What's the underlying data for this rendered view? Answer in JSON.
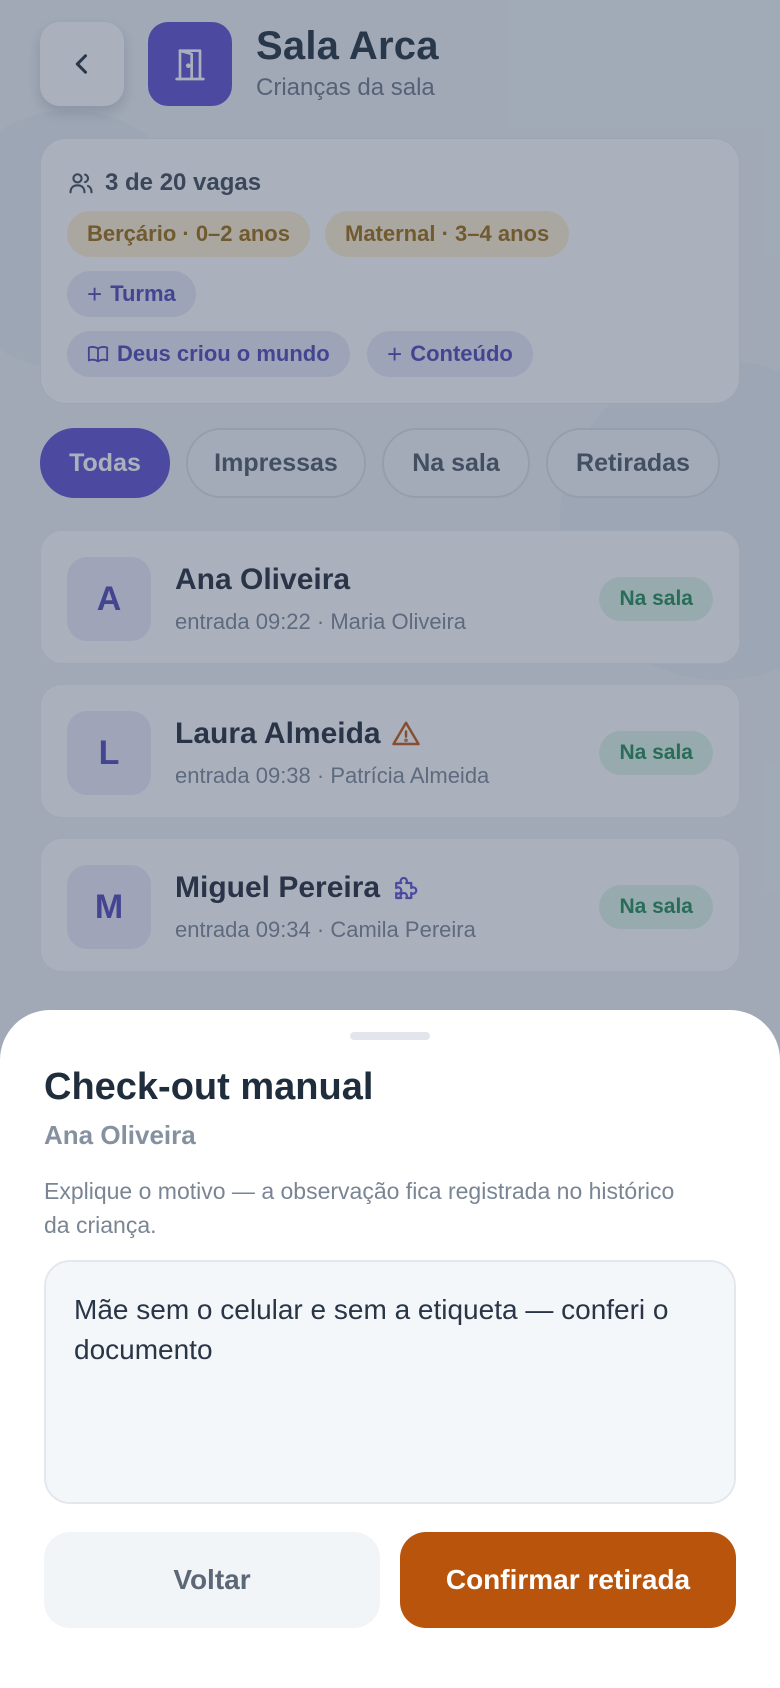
{
  "header": {
    "title": "Sala Arca",
    "subtitle": "Crianças da sala",
    "back_icon": "chevron-left-icon",
    "room_icon": "door-icon"
  },
  "info": {
    "vagas": "3 de 20 vagas",
    "age_groups": [
      "Berçário · 0–2 anos",
      "Maternal · 3–4 anos"
    ],
    "add_turma": "Turma",
    "content": "Deus criou o mundo",
    "add_conteudo": "Conteúdo"
  },
  "filters": [
    "Todas",
    "Impressas",
    "Na sala",
    "Retiradas"
  ],
  "filter_active": "Todas",
  "children": [
    {
      "initial": "A",
      "name": "Ana Oliveira",
      "meta": "entrada 09:22 · Maria Oliveira",
      "status": "Na sala",
      "flag": ""
    },
    {
      "initial": "L",
      "name": "Laura Almeida",
      "meta": "entrada 09:38 · Patrícia Almeida",
      "status": "Na sala",
      "flag": "warning-icon"
    },
    {
      "initial": "M",
      "name": "Miguel Pereira",
      "meta": "entrada 09:34 · Camila Pereira",
      "status": "Na sala",
      "flag": "puzzle-icon"
    }
  ],
  "sheet": {
    "title": "Check-out manual",
    "child_name": "Ana Oliveira",
    "description": "Explique o motivo — a observação fica registrada no histórico da criança.",
    "reason_value": "Mãe sem o celular e sem a etiqueta — conferi o documento",
    "back_label": "Voltar",
    "confirm_label": "Confirmar retirada"
  },
  "colors": {
    "primary": "#5a4fcf",
    "confirm": "#b8540c",
    "status_bg": "#dcf3e6",
    "status_text": "#1f8a55",
    "age_chip_bg": "#fbeecf",
    "age_chip_text": "#9b6a0e"
  }
}
